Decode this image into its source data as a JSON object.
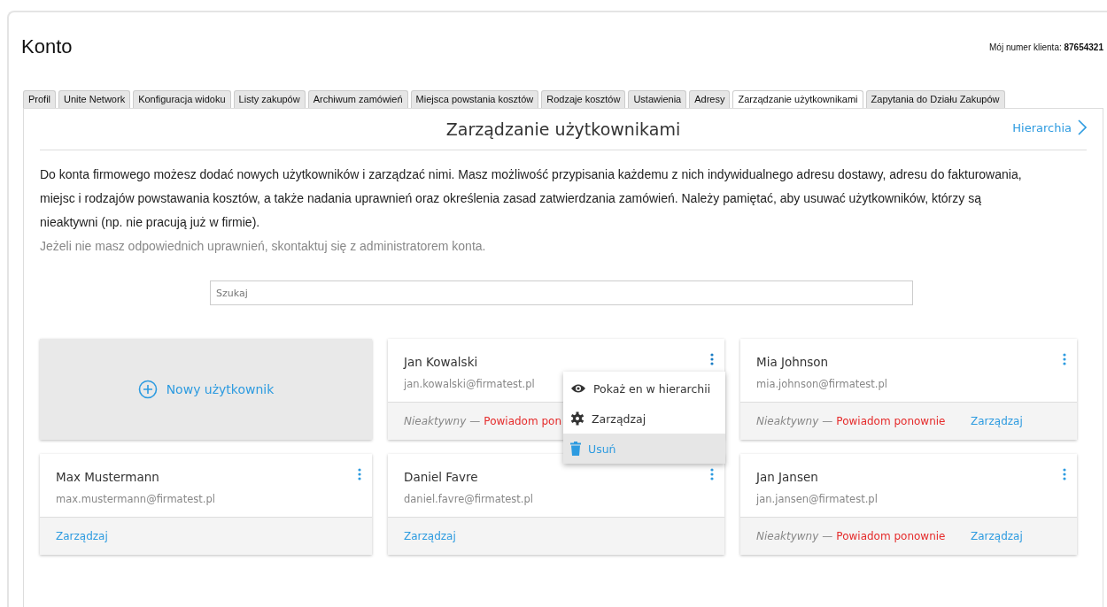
{
  "page_title": "Konto",
  "customer_number": {
    "label": "Mój numer klienta:",
    "value": "87654321"
  },
  "tabs": [
    {
      "label": "Profil",
      "selected": false
    },
    {
      "label": "Unite Network",
      "selected": false
    },
    {
      "label": "Konfiguracja widoku",
      "selected": false
    },
    {
      "label": "Listy zakupów",
      "selected": false
    },
    {
      "label": "Archiwum zamówień",
      "selected": false
    },
    {
      "label": "Miejsca powstania kosztów",
      "selected": false
    },
    {
      "label": "Rodzaje kosztów",
      "selected": false
    },
    {
      "label": "Ustawienia",
      "selected": false
    },
    {
      "label": "Adresy",
      "selected": false
    },
    {
      "label": "Zarządzanie użytkownikami",
      "selected": true
    },
    {
      "label": "Zapytania do Działu Zakupów",
      "selected": false
    }
  ],
  "section": {
    "title": "Zarządzanie użytkownikami",
    "hierarchy_link": "Hierarchia",
    "description": "Do konta firmowego możesz dodać nowych użytkowników i zarządzać nimi. Masz możliwość przypisania każdemu z nich indywidualnego adresu dostawy, adresu do fakturowania, miejsc i rodzajów powstawania kosztów, a także nadania uprawnień oraz określenia zasad zatwierdzania zamówień. Należy pamiętać, aby usuwać użytkowników, którzy są nieaktywni (np. nie pracują już w firmie).",
    "hint": "Jeżeli nie masz odpowiednich uprawnień, skontaktuj się z administratorem konta."
  },
  "search": {
    "placeholder": "Szukaj"
  },
  "new_user": {
    "label": "Nowy użytkownik"
  },
  "users": [
    {
      "name": "Jan Kowalski",
      "email": "jan.kowalski@firmatest.pl",
      "status": "Nieaktywny",
      "separator": "—",
      "resend": "Powiadom pon",
      "menu_open": true
    },
    {
      "name": "Mia Johnson",
      "email": "mia.johnson@firmatest.pl",
      "status": "Nieaktywny",
      "separator": "—",
      "resend": "Powiadom ponownie",
      "manage": "Zarządzaj",
      "menu_open": false
    },
    {
      "name": "Max Mustermann",
      "email": "max.mustermann@firmatest.pl",
      "manage": "Zarządzaj",
      "menu_open": false
    },
    {
      "name": "Daniel Favre",
      "email": "daniel.favre@firmatest.pl",
      "manage": "Zarządzaj",
      "menu_open": false
    },
    {
      "name": "Jan Jansen",
      "email": "jan.jansen@firmatest.pl",
      "status": "Nieaktywny",
      "separator": "—",
      "resend": "Powiadom ponownie",
      "manage": "Zarządzaj",
      "menu_open": false
    }
  ],
  "context_menu": [
    {
      "kind": "eye",
      "label": "Pokaż en w hierarchii",
      "selected": false
    },
    {
      "kind": "gear",
      "label": "Zarządzaj",
      "selected": false
    },
    {
      "kind": "trash",
      "label": "Usuń",
      "selected": true
    }
  ]
}
